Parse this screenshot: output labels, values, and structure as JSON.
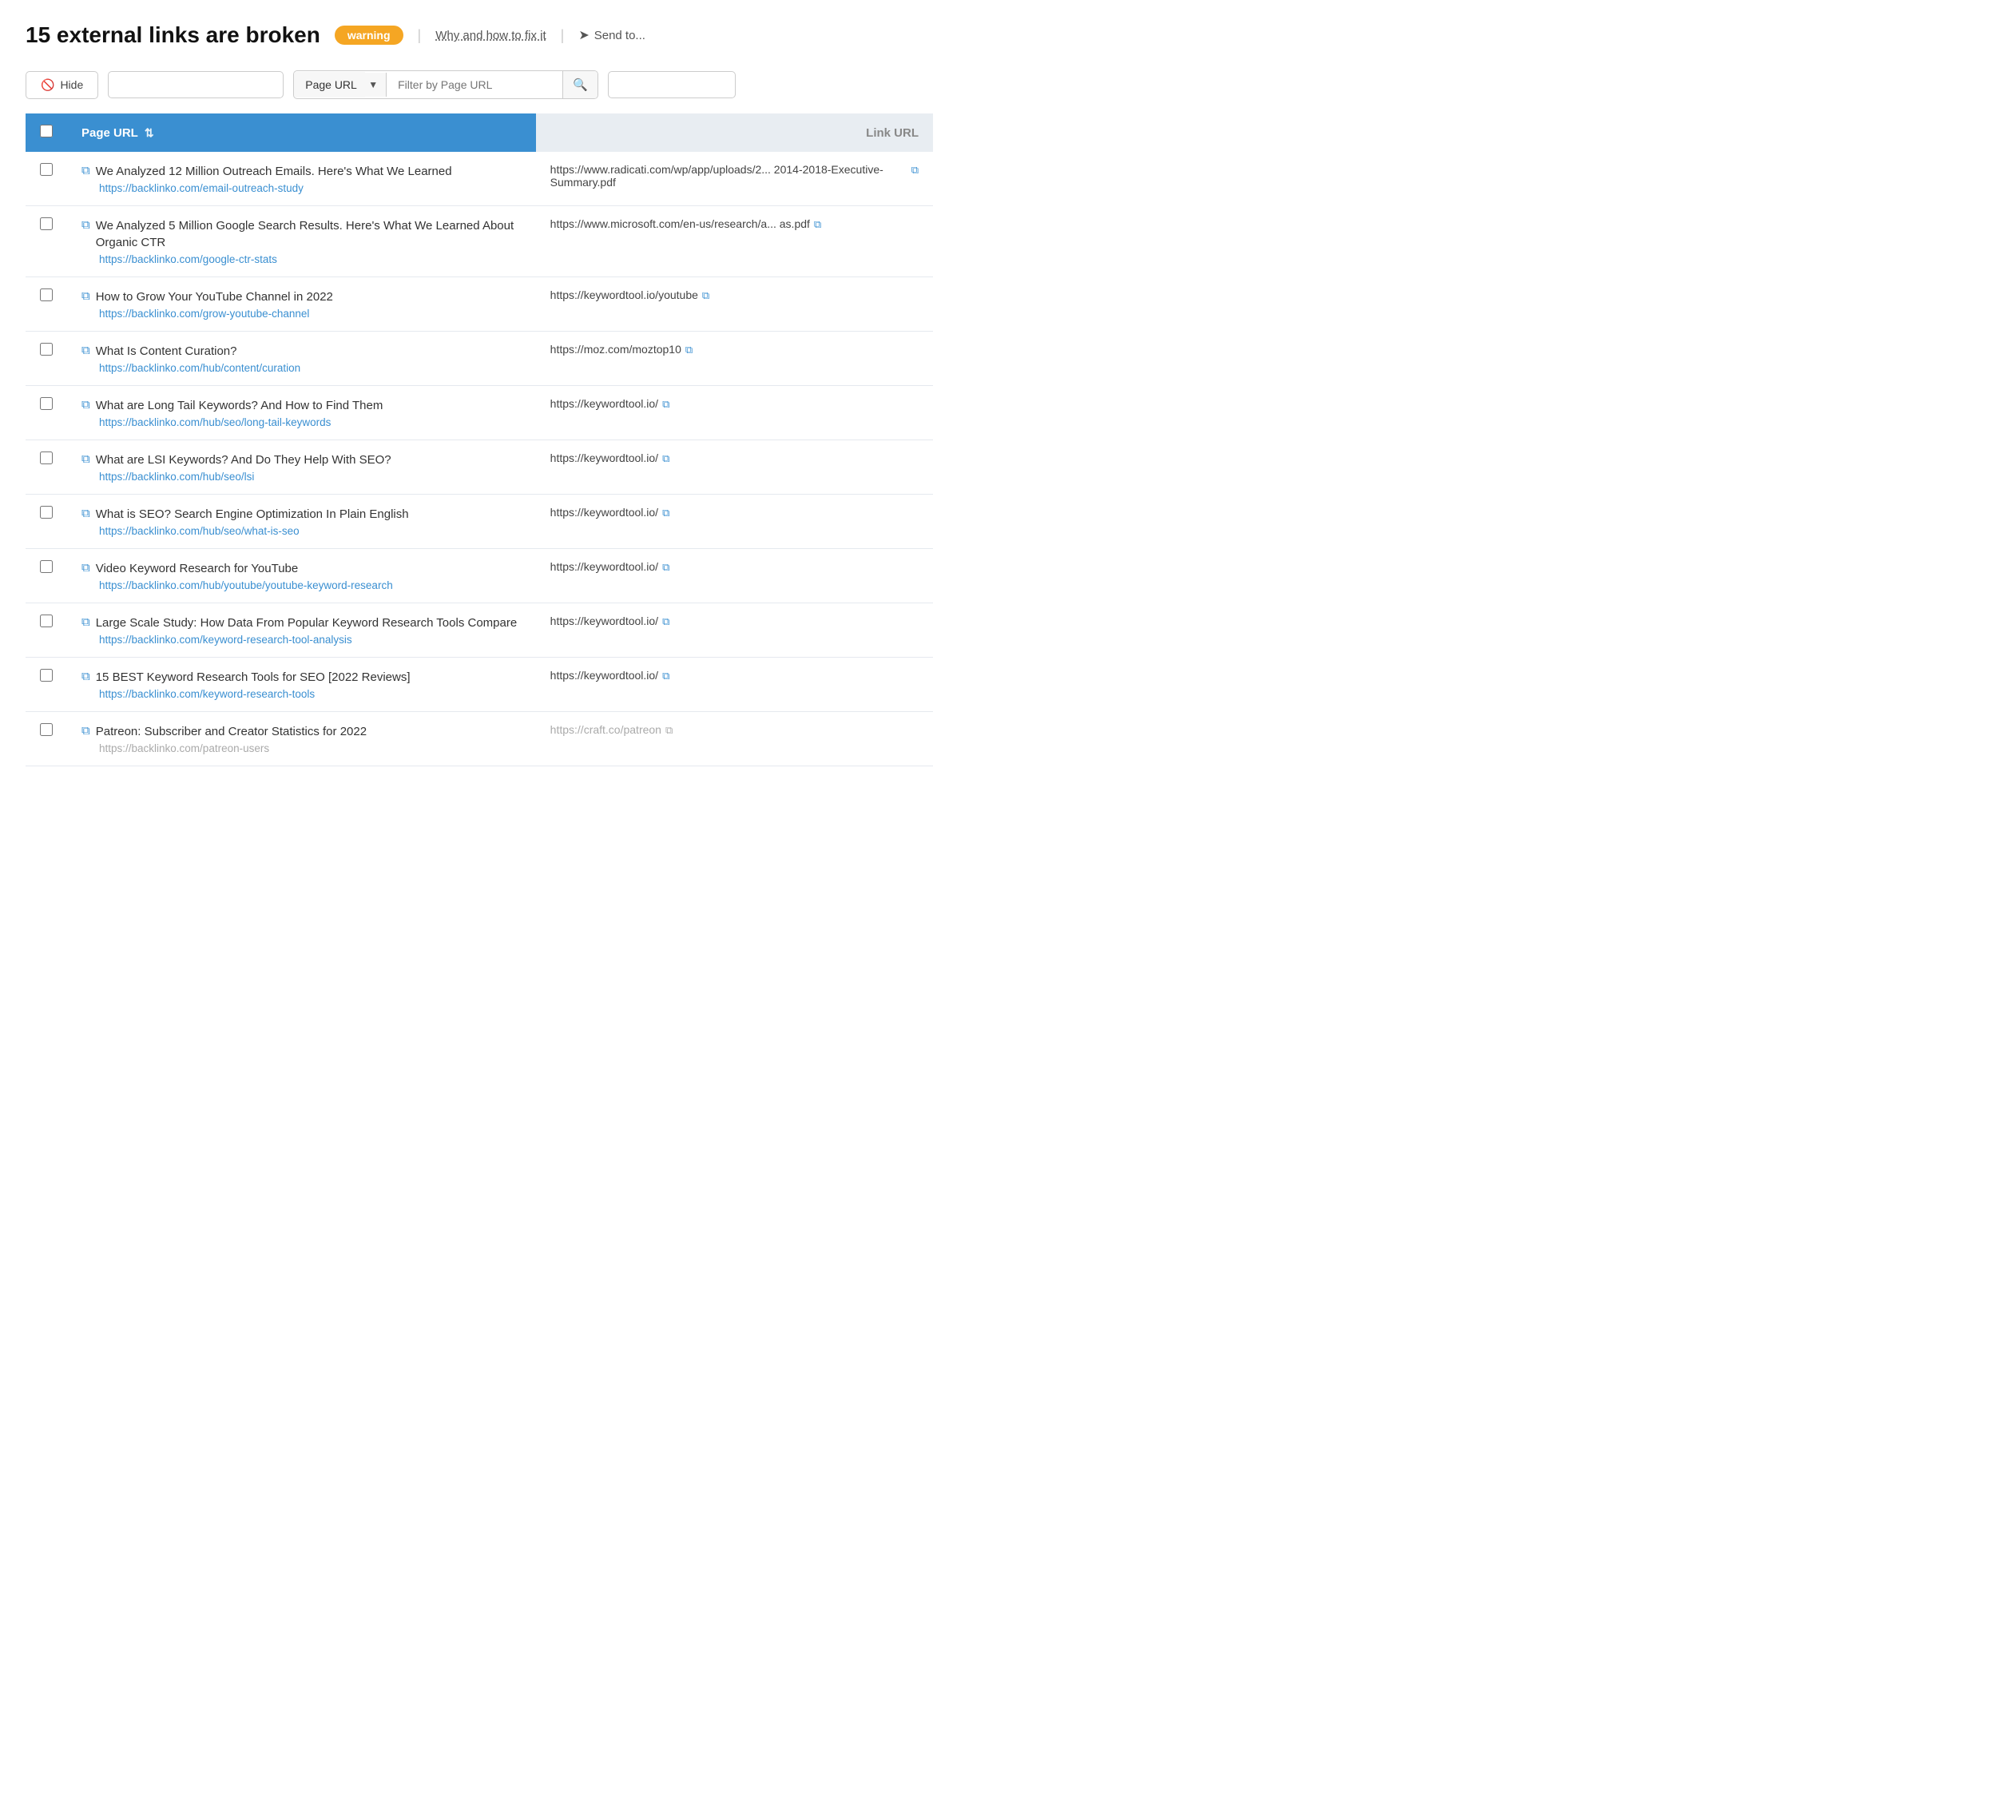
{
  "header": {
    "title": "15 external links are broken",
    "badge": "warning",
    "link_label": "Why and how to fix it",
    "send_label": "Send to..."
  },
  "toolbar": {
    "hide_label": "Hide",
    "search_placeholder": "",
    "filter_label": "Page URL",
    "filter_placeholder": "Filter by Page URL",
    "extra_filter_placeholder": ""
  },
  "table": {
    "col_page_url": "Page URL",
    "col_link_url": "Link URL",
    "rows": [
      {
        "page_title": "We Analyzed 12 Million Outreach Emails. Here's What We Learned",
        "page_url": "https://backlinko.com/email-outreach-study",
        "link_url": "https://www.radicati.com/wp/app/uploads/2... 2014-2018-Executive-Summary.pdf",
        "link_has_icon": true,
        "faded": false
      },
      {
        "page_title": "We Analyzed 5 Million Google Search Results. Here's What We Learned About Organic CTR",
        "page_url": "https://backlinko.com/google-ctr-stats",
        "link_url": "https://www.microsoft.com/en-us/research/a... as.pdf",
        "link_has_icon": true,
        "faded": false
      },
      {
        "page_title": "How to Grow Your YouTube Channel in 2022",
        "page_url": "https://backlinko.com/grow-youtube-channel",
        "link_url": "https://keywordtool.io/youtube",
        "link_has_icon": true,
        "faded": false
      },
      {
        "page_title": "What Is Content Curation?",
        "page_url": "https://backlinko.com/hub/content/curation",
        "link_url": "https://moz.com/moztop10",
        "link_has_icon": true,
        "faded": false
      },
      {
        "page_title": "What are Long Tail Keywords? And How to Find Them",
        "page_url": "https://backlinko.com/hub/seo/long-tail-keywords",
        "link_url": "https://keywordtool.io/",
        "link_has_icon": true,
        "faded": false
      },
      {
        "page_title": "What are LSI Keywords? And Do They Help With SEO?",
        "page_url": "https://backlinko.com/hub/seo/lsi",
        "link_url": "https://keywordtool.io/",
        "link_has_icon": true,
        "faded": false
      },
      {
        "page_title": "What is SEO? Search Engine Optimization In Plain English",
        "page_url": "https://backlinko.com/hub/seo/what-is-seo",
        "link_url": "https://keywordtool.io/",
        "link_has_icon": true,
        "faded": false
      },
      {
        "page_title": "Video Keyword Research for YouTube",
        "page_url": "https://backlinko.com/hub/youtube/youtube-keyword-research",
        "link_url": "https://keywordtool.io/",
        "link_has_icon": true,
        "faded": false
      },
      {
        "page_title": "Large Scale Study: How Data From Popular Keyword Research Tools Compare",
        "page_url": "https://backlinko.com/keyword-research-tool-analysis",
        "link_url": "https://keywordtool.io/",
        "link_has_icon": true,
        "faded": false
      },
      {
        "page_title": "15 BEST Keyword Research Tools for SEO [2022 Reviews]",
        "page_url": "https://backlinko.com/keyword-research-tools",
        "link_url": "https://keywordtool.io/",
        "link_has_icon": true,
        "faded": false
      },
      {
        "page_title": "Patreon: Subscriber and Creator Statistics for 2022",
        "page_url": "https://backlinko.com/patreon-users",
        "link_url": "https://craft.co/patreon",
        "link_has_icon": true,
        "faded": true
      }
    ]
  }
}
